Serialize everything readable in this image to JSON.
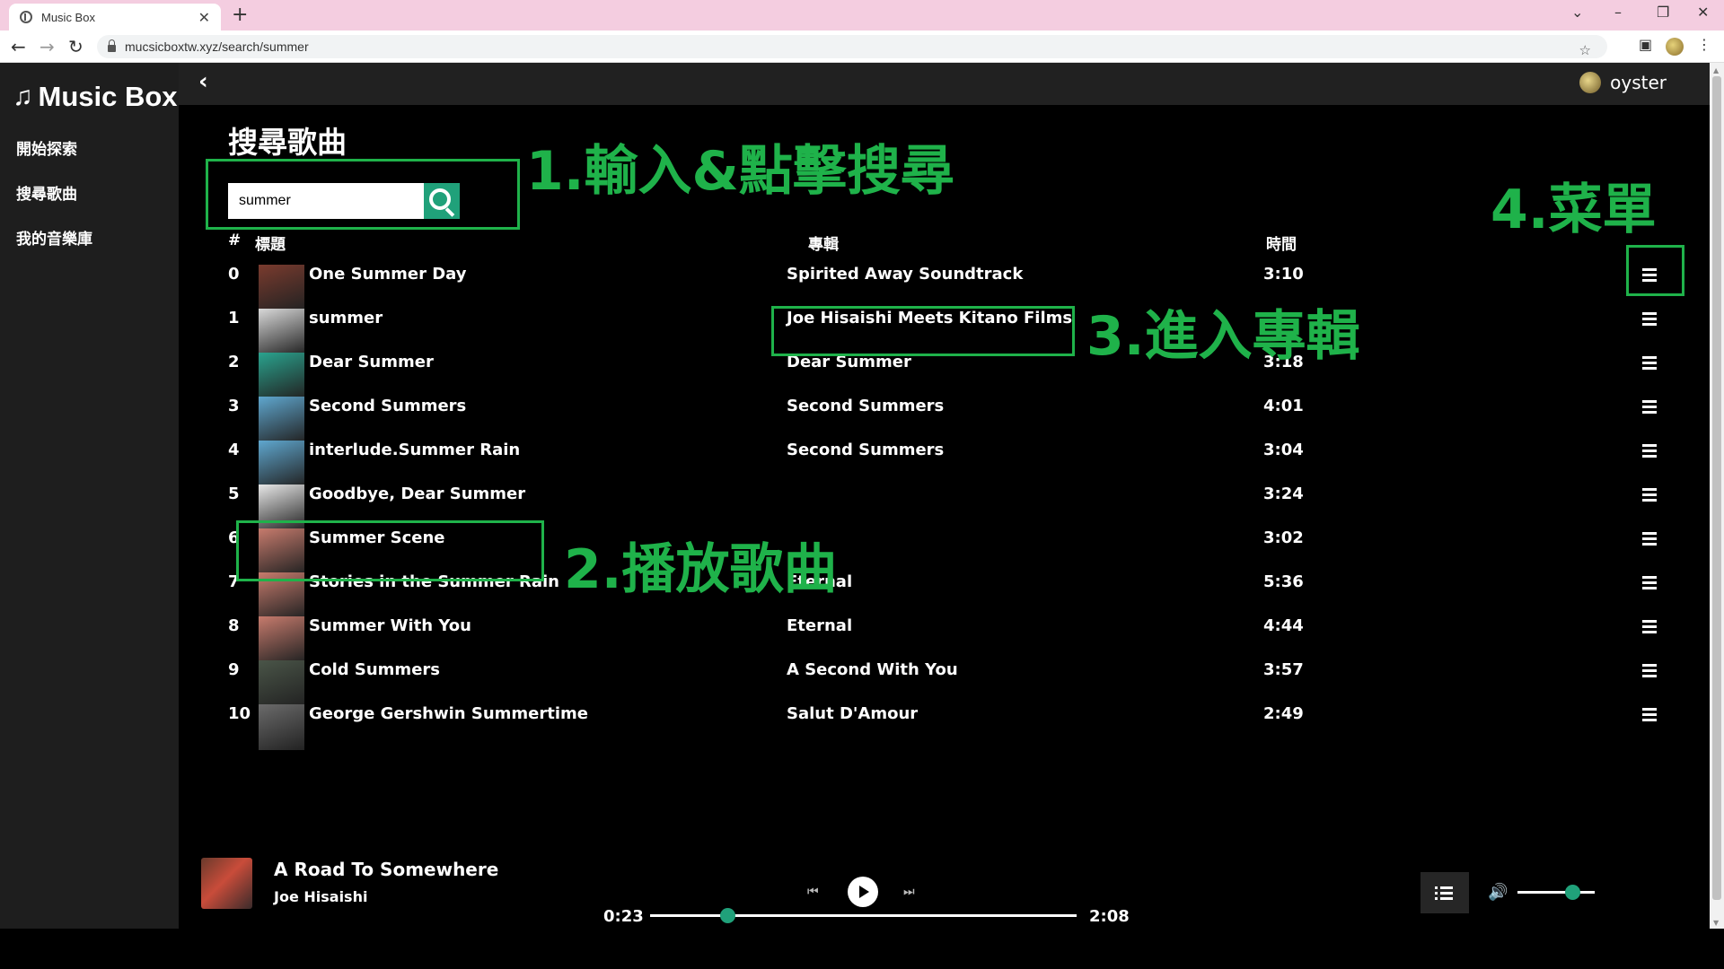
{
  "browser": {
    "tab_title": "Music Box",
    "tab_close": "✕",
    "new_tab": "+",
    "url": "mucsicboxtw.xyz/search/summer"
  },
  "app": {
    "logo": "Music Box",
    "nav": [
      "開始探索",
      "搜尋歌曲",
      "我的音樂庫"
    ],
    "username": "oyster",
    "page_title": "搜尋歌曲",
    "search_value": "summer",
    "headers": {
      "index": "#",
      "title": "標題",
      "album": "專輯",
      "time": "時間"
    }
  },
  "songs": [
    {
      "index": "0",
      "title": "One Summer Day",
      "album": "Spirited Away Soundtrack",
      "time": "3:10",
      "cover_color": "#7a3b2e"
    },
    {
      "index": "1",
      "title": "summer",
      "album": "Joe Hisaishi Meets Kitano Films",
      "time": "",
      "cover_color": "#d9d9d9"
    },
    {
      "index": "2",
      "title": "Dear Summer",
      "album": "Dear Summer",
      "time": "3:18",
      "cover_color": "#2aa38e"
    },
    {
      "index": "3",
      "title": "Second Summers",
      "album": "Second Summers",
      "time": "4:01",
      "cover_color": "#5fa7cf"
    },
    {
      "index": "4",
      "title": "interlude.Summer Rain",
      "album": "Second Summers",
      "time": "3:04",
      "cover_color": "#5fa7cf"
    },
    {
      "index": "5",
      "title": "Goodbye, Dear Summer",
      "album": "",
      "time": "3:24",
      "cover_color": "#e8e8e8"
    },
    {
      "index": "6",
      "title": "Summer Scene",
      "album": "",
      "time": "3:02",
      "cover_color": "#c77b6d"
    },
    {
      "index": "7",
      "title": "Stories in the Summer Rain",
      "album": "Eternal",
      "time": "5:36",
      "cover_color": "#c77b6d"
    },
    {
      "index": "8",
      "title": "Summer With You",
      "album": "Eternal",
      "time": "4:44",
      "cover_color": "#c77b6d"
    },
    {
      "index": "9",
      "title": "Cold Summers",
      "album": "A Second With You",
      "time": "3:57",
      "cover_color": "#4a5548"
    },
    {
      "index": "10",
      "title": "George Gershwin Summertime",
      "album": "Salut D'Amour",
      "time": "2:49",
      "cover_color": "#6b6b6b"
    }
  ],
  "annotations": {
    "search": "1.輸入&點擊搜尋",
    "play": "2.播放歌曲",
    "album": "3.進入專輯",
    "menu": "4.菜單",
    "color": "#1fb24a"
  },
  "player": {
    "title": "A Road To Somewhere",
    "artist": "Joe Hisaishi",
    "current_time": "0:23",
    "total_time": "2:08",
    "progress_fraction": 0.18,
    "volume_fraction": 0.71,
    "accent": "#20a17a"
  },
  "icons": {
    "back": "chevron-left-icon",
    "search": "search-icon",
    "menu": "hamburger-menu-icon",
    "play": "play-icon",
    "prev": "skip-previous-icon",
    "next": "skip-next-icon",
    "queue": "queue-list-icon",
    "volume": "volume-icon"
  }
}
